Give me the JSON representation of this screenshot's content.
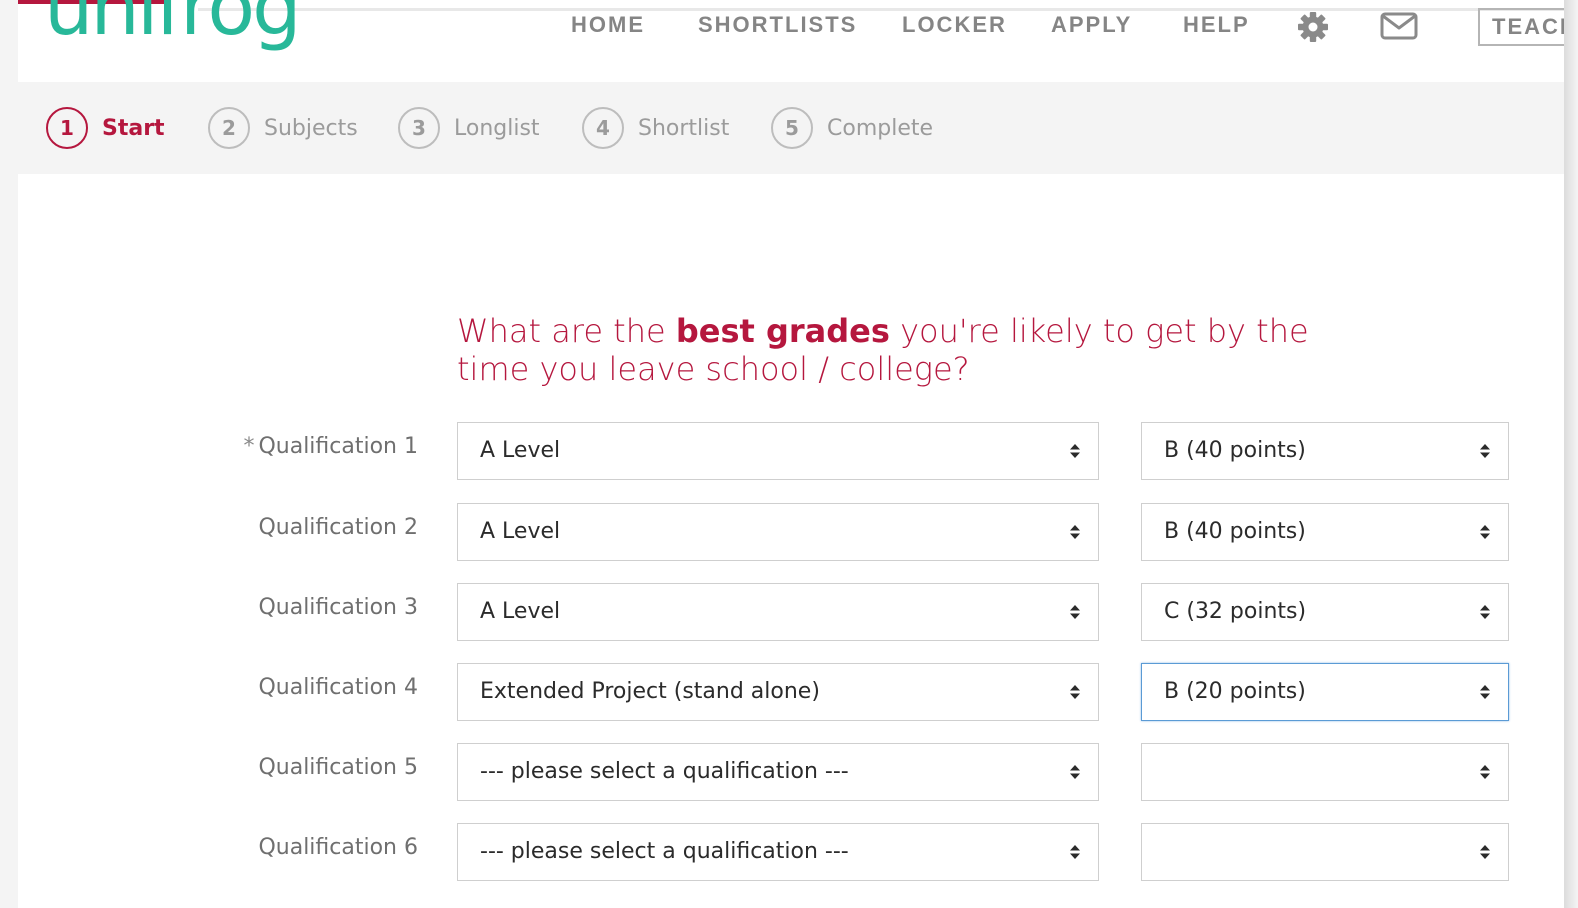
{
  "logo": {
    "text": "unifrog"
  },
  "nav": {
    "items": [
      "HOME",
      "SHORTLISTS",
      "LOCKER",
      "APPLY",
      "HELP"
    ],
    "settings_icon": "gear-icon",
    "mail_icon": "envelope-icon",
    "teach_label": "TEACH"
  },
  "steps": [
    {
      "number": "1",
      "label": "Start",
      "active": true
    },
    {
      "number": "2",
      "label": "Subjects",
      "active": false
    },
    {
      "number": "3",
      "label": "Longlist",
      "active": false
    },
    {
      "number": "4",
      "label": "Shortlist",
      "active": false
    },
    {
      "number": "5",
      "label": "Complete",
      "active": false
    }
  ],
  "heading": {
    "before": "What are the ",
    "bold": "best grades",
    "after": " you're likely to get by the time you leave school / college?"
  },
  "required_marker": "*",
  "qualifications": [
    {
      "label": "Qualification 1",
      "required": true,
      "qualification": "A Level",
      "grade": "B (40 points)"
    },
    {
      "label": "Qualification 2",
      "required": false,
      "qualification": "A Level",
      "grade": "B (40 points)"
    },
    {
      "label": "Qualification 3",
      "required": false,
      "qualification": "A Level",
      "grade": "C (32 points)"
    },
    {
      "label": "Qualification 4",
      "required": false,
      "qualification": "Extended Project (stand alone)",
      "grade": "B (20 points)",
      "grade_focused": true
    },
    {
      "label": "Qualification 5",
      "required": false,
      "qualification": "--- please select a qualification ---",
      "grade": ""
    },
    {
      "label": "Qualification 6",
      "required": false,
      "qualification": "--- please select a qualification ---",
      "grade": ""
    }
  ],
  "colors": {
    "brand_green": "#28b899",
    "accent_red": "#b5173e",
    "nav_grey": "#858585",
    "focus_blue": "#5b9bd5"
  }
}
